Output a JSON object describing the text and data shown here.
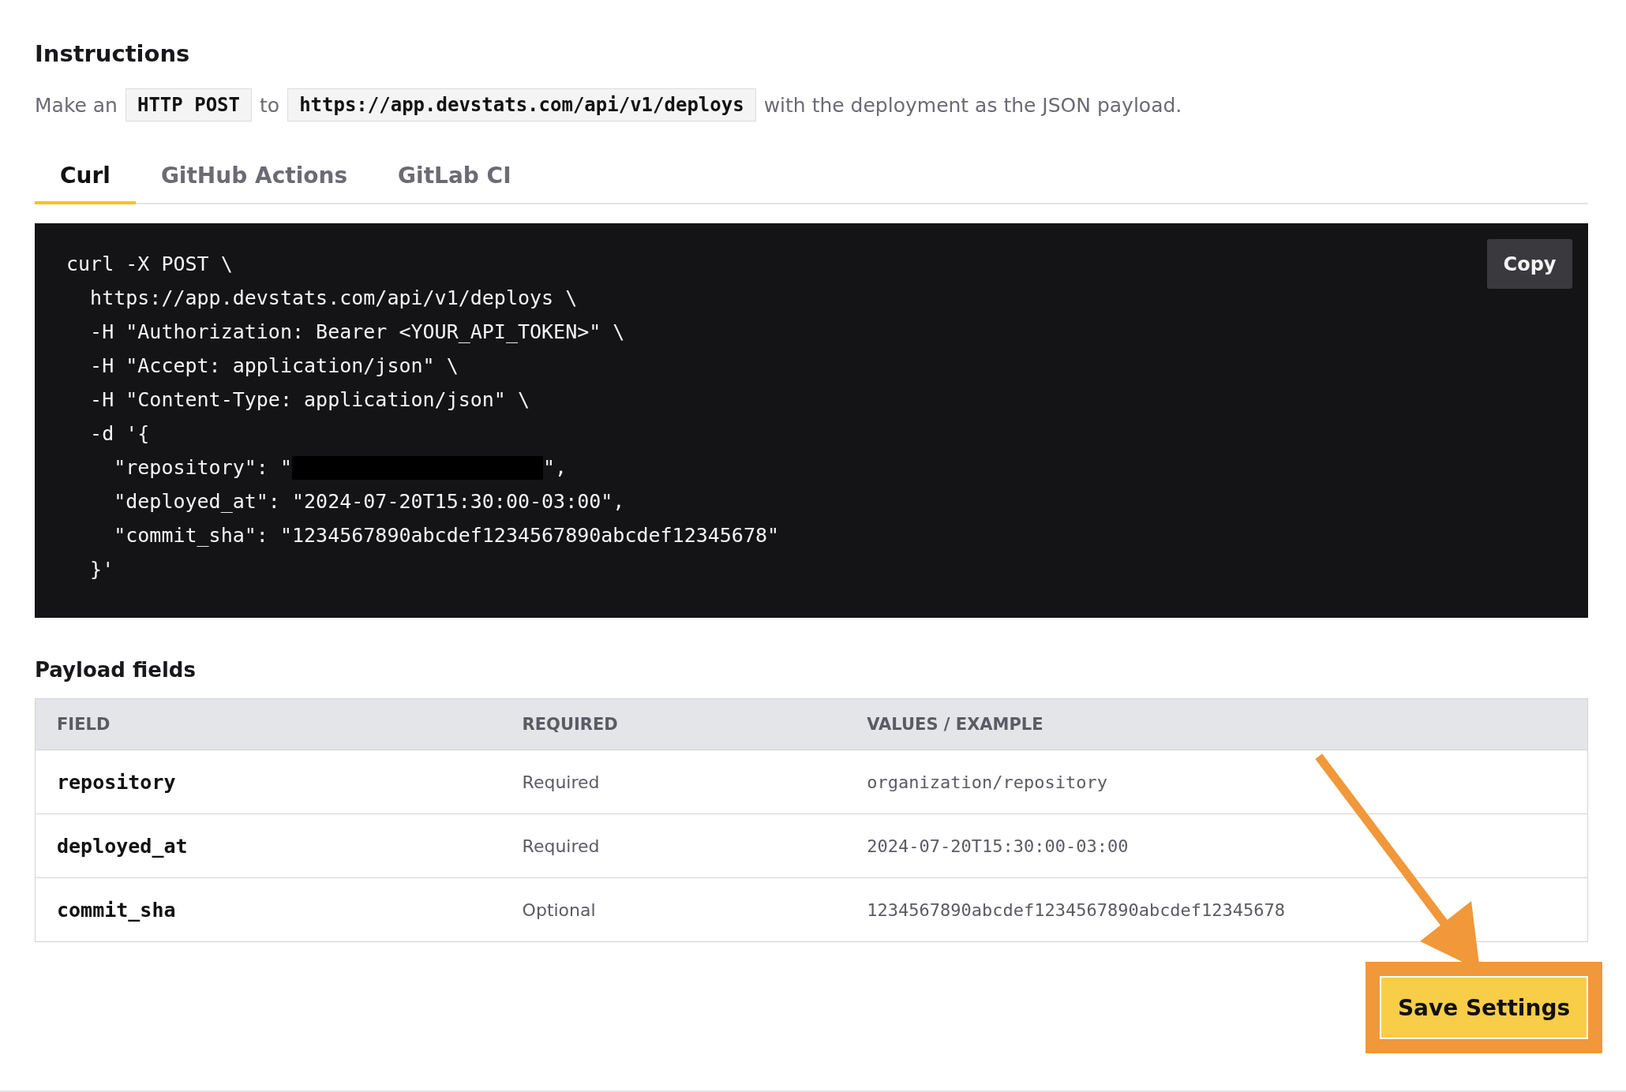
{
  "heading": "Instructions",
  "intro": {
    "before": "Make an",
    "method": "HTTP POST",
    "middle": "to",
    "url": "https://app.devstats.com/api/v1/deploys",
    "after": "with the deployment as the JSON payload."
  },
  "tabs": [
    {
      "label": "Curl",
      "selected": true
    },
    {
      "label": "GitHub Actions",
      "selected": false
    },
    {
      "label": "GitLab CI",
      "selected": false
    }
  ],
  "code": {
    "copy_label": "Copy",
    "lines": [
      {
        "kind": "text",
        "text": "curl -X POST \\"
      },
      {
        "kind": "text",
        "text": "  https://app.devstats.com/api/v1/deploys \\"
      },
      {
        "kind": "text",
        "text": "  -H \"Authorization: Bearer <YOUR_API_TOKEN>\" \\"
      },
      {
        "kind": "text",
        "text": "  -H \"Accept: application/json\" \\"
      },
      {
        "kind": "text",
        "text": "  -H \"Content-Type: application/json\" \\"
      },
      {
        "kind": "text",
        "text": "  -d '{"
      },
      {
        "kind": "redacted",
        "before": "    \"repository\": \"",
        "after": "\","
      },
      {
        "kind": "text",
        "text": "    \"deployed_at\": \"2024-07-20T15:30:00-03:00\","
      },
      {
        "kind": "text",
        "text": "    \"commit_sha\": \"1234567890abcdef1234567890abcdef12345678\""
      },
      {
        "kind": "text",
        "text": "  }'"
      }
    ]
  },
  "payload": {
    "title": "Payload fields",
    "columns": [
      "FIELD",
      "REQUIRED",
      "VALUES / EXAMPLE"
    ],
    "rows": [
      {
        "field": "repository",
        "required": "Required",
        "example": "organization/repository"
      },
      {
        "field": "deployed_at",
        "required": "Required",
        "example": "2024-07-20T15:30:00-03:00"
      },
      {
        "field": "commit_sha",
        "required": "Optional",
        "example": "1234567890abcdef1234567890abcdef12345678"
      }
    ]
  },
  "save_button": {
    "label": "Save Settings",
    "highlighted": true
  }
}
